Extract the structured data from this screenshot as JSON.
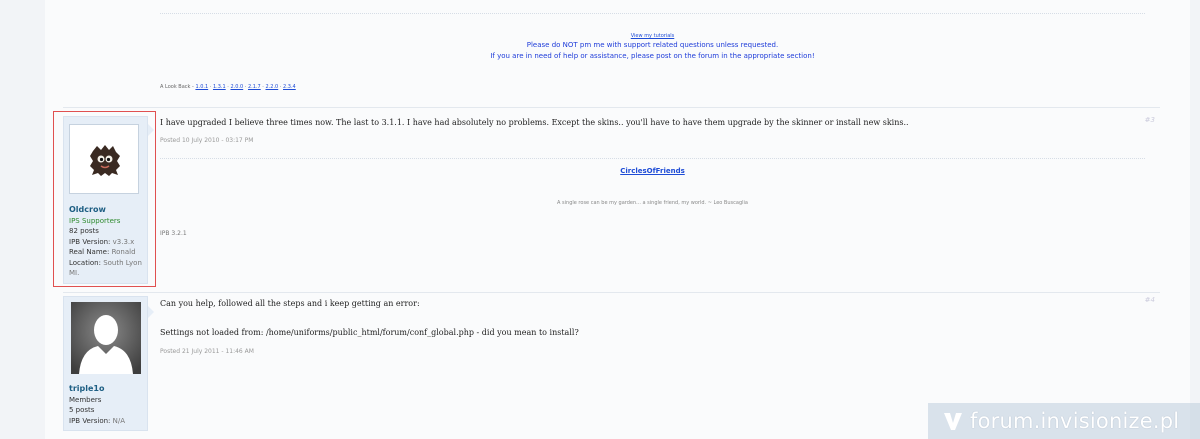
{
  "top_signature": {
    "tutorials_link": "View my tutorials",
    "notice_line1": "Please do NOT pm me with support related questions unless requested.",
    "notice_line2": "If you are in need of help or assistance, please post on the forum in the appropriate section!",
    "look_back_label": "A Look Back -",
    "look_back_versions": [
      "1.0.1",
      "1.3.1",
      "2.0.0",
      "2.1.7",
      "2.2.0",
      "2.3.4"
    ]
  },
  "posts": [
    {
      "author": {
        "name": "Oldcrow",
        "group": "IPS Supporters",
        "posts": "82 posts",
        "ipb_version_label": "IPB Version:",
        "ipb_version": "v3.3.x",
        "real_name_label": "Real Name:",
        "real_name": "Ronald",
        "location_label": "Location:",
        "location_line1": "South Lyon",
        "location_line2": "MI."
      },
      "number": "#3",
      "body": "I have upgraded I believe three times now. The last to 3.1.1. I have had absolutely no problems. Except the skins.. you'll have to have them upgrade by the skinner or install new skins..",
      "date": "Posted 10 July 2010 - 03:17 PM",
      "signature": {
        "link": "CirclesOfFriends",
        "quote": "A single rose can be my garden... a single friend, my world. ~ Leo Buscaglia",
        "version": "IPB 3.2.1"
      }
    },
    {
      "author": {
        "name": "triple1o",
        "group": "Members",
        "posts": "5 posts",
        "ipb_version_label": "IPB Version:",
        "ipb_version": "N/A"
      },
      "number": "#4",
      "body_line1": "Can you help, followed all the steps and i keep getting an error:",
      "body_line2": "Settings not loaded from: /home/uniforms/public_html/forum/conf_global.php - did you mean to install?",
      "date": "Posted 21 July 2011 - 11:46 AM"
    }
  ],
  "watermark": {
    "text": "forum.invisionize.pl",
    "icon": "invisionize-logo-icon"
  },
  "colors": {
    "link_blue": "#1e4cd6",
    "author_name": "#1d5e83",
    "group_green": "#2e8a2e",
    "highlight_red": "#e05050"
  }
}
